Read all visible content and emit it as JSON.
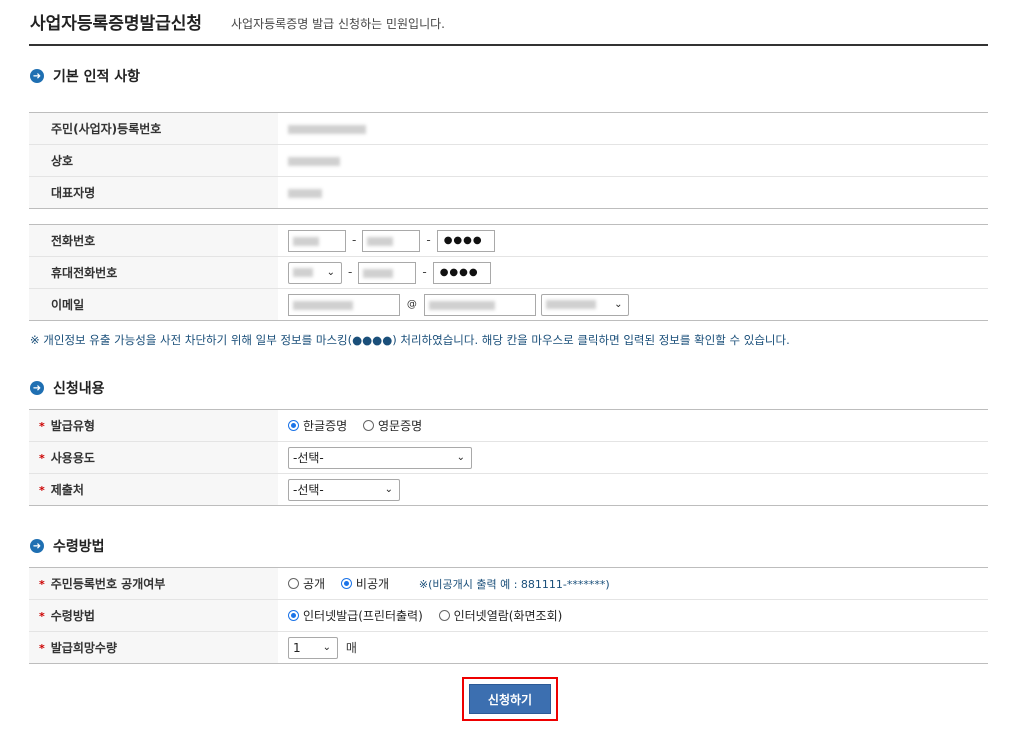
{
  "header": {
    "title": "사업자등록증명발급신청",
    "subtitle": "사업자등록증명 발급 신청하는 민원입니다."
  },
  "sections": {
    "basic": "기본 인적 사항",
    "apply": "신청내용",
    "receive": "수령방법"
  },
  "basic_info": {
    "reg_no_label": "주민(사업자)등록번호",
    "company_label": "상호",
    "ceo_label": "대표자명"
  },
  "contact": {
    "phone_label": "전화번호",
    "mobile_label": "휴대전화번호",
    "email_label": "이메일",
    "masked": "●●●●",
    "at": "@"
  },
  "notice": "※ 개인정보 유출 가능성을 사전 차단하기 위해 일부 정보를 마스킹(●●●●) 처리하였습니다. 해당 칸을 마우스로 클릭하면 입력된 정보를 확인할 수 있습니다.",
  "apply": {
    "type_label": "발급유형",
    "type_options": [
      "한글증명",
      "영문증명"
    ],
    "type_selected": "한글증명",
    "usage_label": "사용용도",
    "usage_value": "-선택-",
    "submit_to_label": "제출처",
    "submit_to_value": "-선택-"
  },
  "receive": {
    "disclose_label": "주민등록번호 공개여부",
    "disclose_options": [
      "공개",
      "비공개"
    ],
    "disclose_selected": "비공개",
    "disclose_hint": "※(비공개시 출력 예 : 881111-*******)",
    "method_label": "수령방법",
    "method_options": [
      "인터넷발급(프린터출력)",
      "인터넷열람(화면조회)"
    ],
    "method_selected": "인터넷발급(프린터출력)",
    "copies_label": "발급희망수량",
    "copies_value": "1",
    "copies_unit": "매"
  },
  "submit_button": "신청하기",
  "colors": {
    "accent": "#3c6fb0",
    "required": "#cc0000",
    "highlight": "#ee0000"
  }
}
